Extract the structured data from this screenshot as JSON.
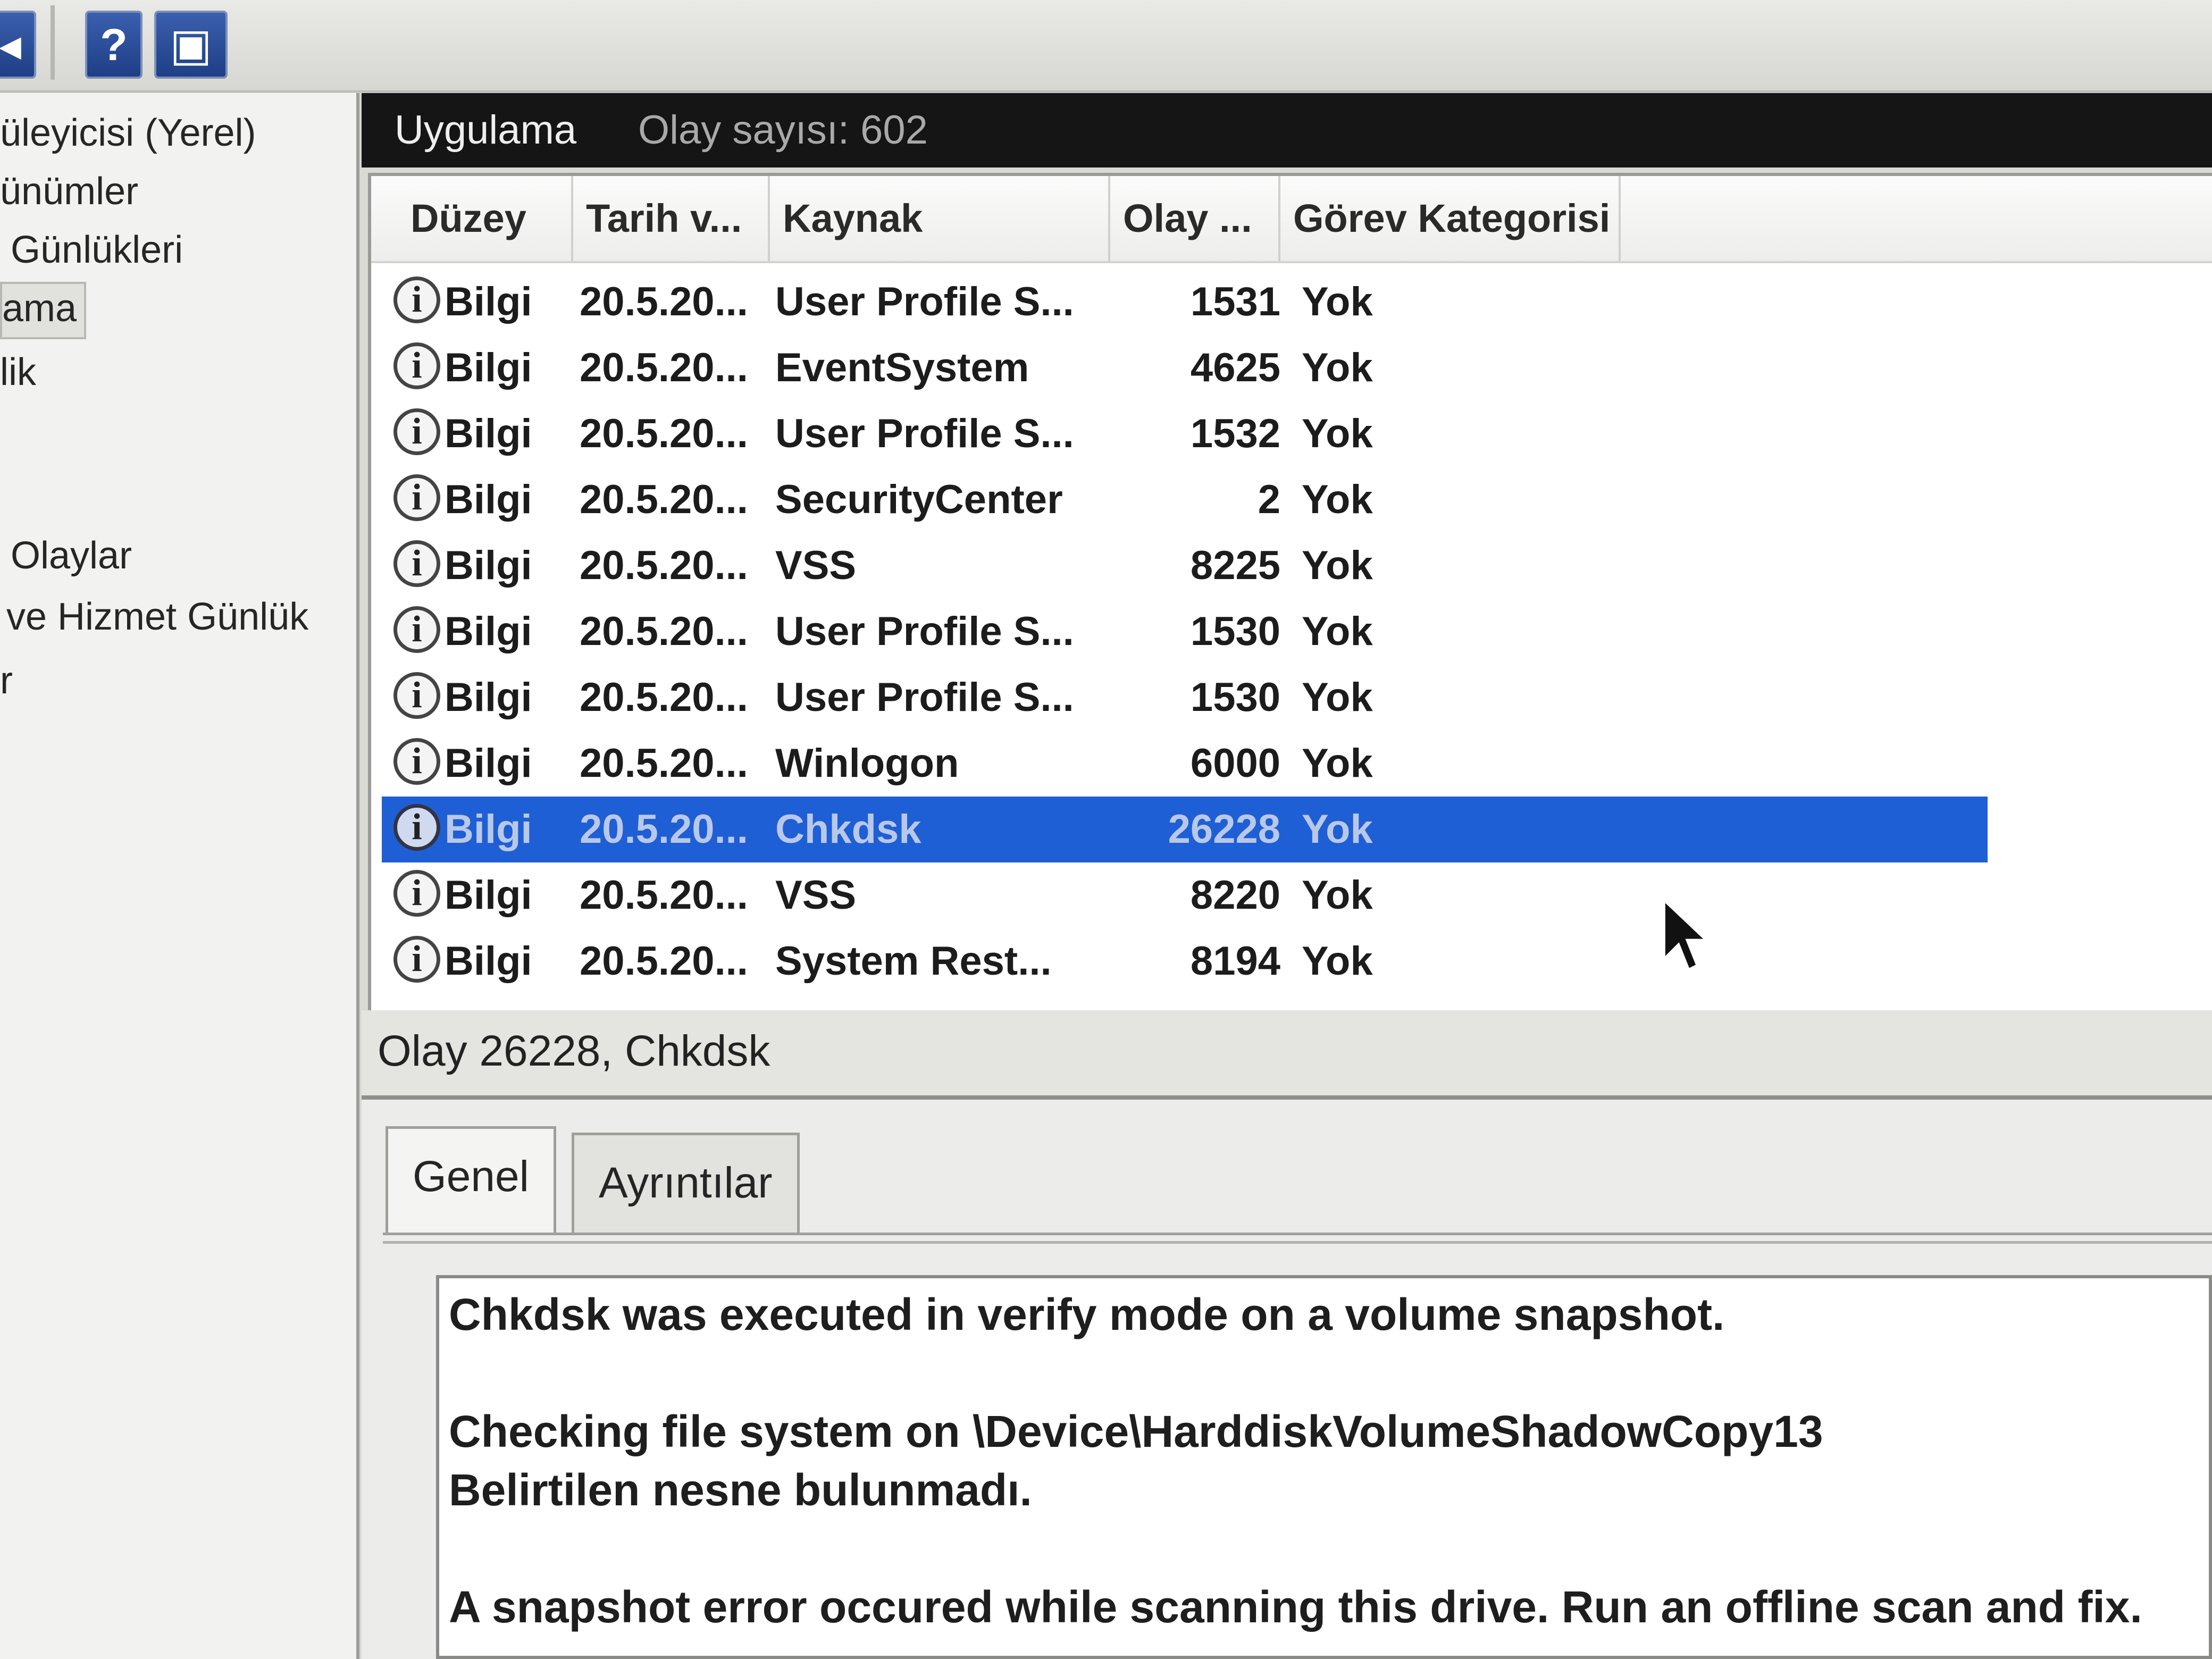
{
  "toolbar": {
    "buttons": [
      {
        "name": "back-arrow-icon",
        "glyph": "◂"
      },
      {
        "name": "help-icon",
        "glyph": "?"
      },
      {
        "name": "panel-view-icon",
        "glyph": "▣"
      }
    ]
  },
  "tree": {
    "items": [
      "üleyicisi (Yerel)",
      "ünümler",
      "Günlükleri",
      "ama",
      "lik",
      "Olaylar",
      "ve Hizmet Günlük",
      "r"
    ]
  },
  "header": {
    "title": "Uygulama",
    "count": "Olay sayısı: 602"
  },
  "columns": [
    "Düzey",
    "Tarih v...",
    "Kaynak",
    "Olay ...",
    "Görev Kategorisi"
  ],
  "rows": [
    {
      "level": "Bilgi",
      "date": "20.5.20...",
      "source": "User Profile S...",
      "event_id": "1531",
      "category": "Yok"
    },
    {
      "level": "Bilgi",
      "date": "20.5.20...",
      "source": "EventSystem",
      "event_id": "4625",
      "category": "Yok"
    },
    {
      "level": "Bilgi",
      "date": "20.5.20...",
      "source": "User Profile S...",
      "event_id": "1532",
      "category": "Yok"
    },
    {
      "level": "Bilgi",
      "date": "20.5.20...",
      "source": "SecurityCenter",
      "event_id": "2",
      "category": "Yok"
    },
    {
      "level": "Bilgi",
      "date": "20.5.20...",
      "source": "VSS",
      "event_id": "8225",
      "category": "Yok"
    },
    {
      "level": "Bilgi",
      "date": "20.5.20...",
      "source": "User Profile S...",
      "event_id": "1530",
      "category": "Yok"
    },
    {
      "level": "Bilgi",
      "date": "20.5.20...",
      "source": "User Profile S...",
      "event_id": "1530",
      "category": "Yok"
    },
    {
      "level": "Bilgi",
      "date": "20.5.20...",
      "source": "Winlogon",
      "event_id": "6000",
      "category": "Yok"
    },
    {
      "level": "Bilgi",
      "date": "20.5.20...",
      "source": "Chkdsk",
      "event_id": "26228",
      "category": "Yok",
      "selected": true
    },
    {
      "level": "Bilgi",
      "date": "20.5.20...",
      "source": "VSS",
      "event_id": "8220",
      "category": "Yok"
    },
    {
      "level": "Bilgi",
      "date": "20.5.20...",
      "source": "System Rest...",
      "event_id": "8194",
      "category": "Yok"
    }
  ],
  "detail": {
    "title": "Olay 26228, Chkdsk",
    "tabs": [
      "Genel",
      "Ayrıntılar"
    ],
    "lines": [
      "Chkdsk was executed in verify mode on a volume snapshot.",
      "Checking file system on \\Device\\HarddiskVolumeShadowCopy13",
      "Belirtilen nesne bulunmadı.",
      "A snapshot error occured while scanning this drive. Run an offline scan and fix."
    ]
  },
  "colors": {
    "selection": "#1e5fd6",
    "header_bar": "#151515"
  }
}
